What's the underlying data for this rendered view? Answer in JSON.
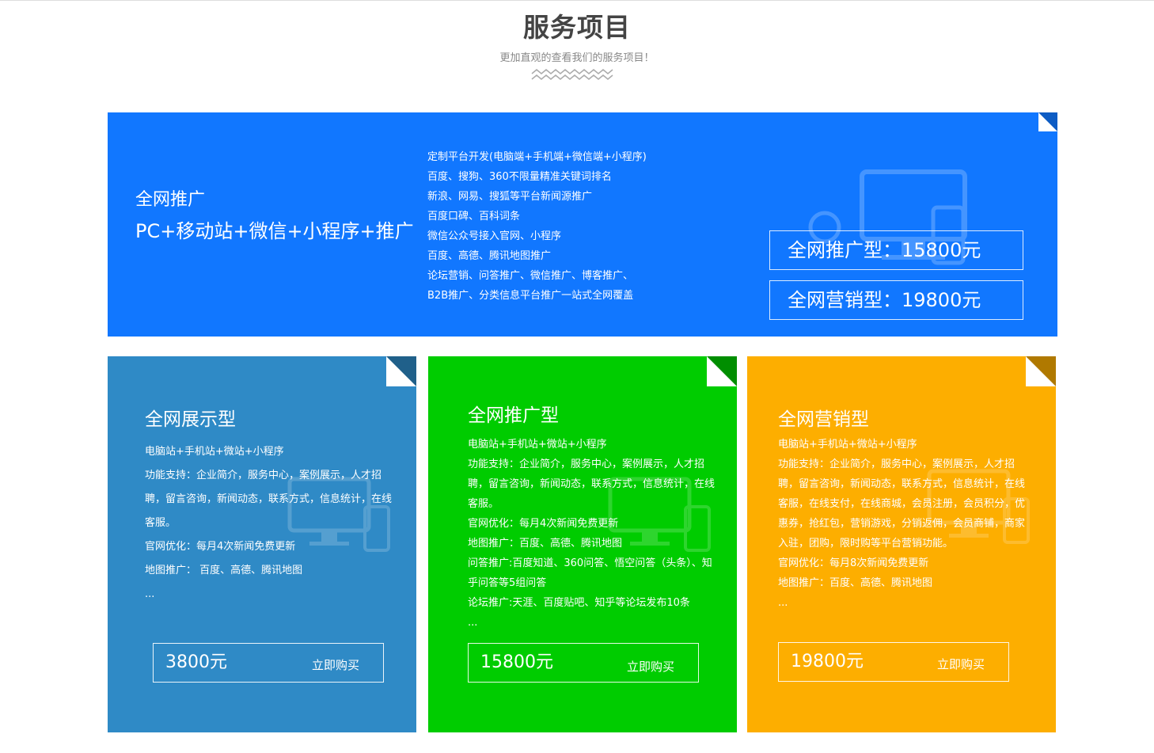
{
  "section": {
    "title": "服务项目",
    "subtitle": "更加直观的查看我们的服务项目！"
  },
  "banner": {
    "title": "全网推广",
    "subtitle": "PC+移动站+微信+小程序+推广",
    "features": [
      "定制平台开发(电脑端+手机端+微信端+小程序)",
      "百度、搜狗、360不限量精准关键词排名",
      "新浪、网易、搜狐等平台新闻源推广",
      "百度口碑、百科词条",
      "微信公众号接入官网、小程序",
      "百度、高德、腾讯地图推广",
      "论坛营销、问答推广、微信推广、博客推广、",
      "B2B推广、分类信息平台推广一站式全网覆盖"
    ],
    "price_options": [
      "全网推广型：15800元",
      "全网营销型：19800元"
    ],
    "color": "#1177ff",
    "icon": "monitor-phone-icon"
  },
  "cards": [
    {
      "title": "全网展示型",
      "features": [
        "电脑站+手机站+微站+小程序",
        "功能支持：企业简介，服务中心，案例展示，人才招聘，留言咨询，新闻动态，联系方式，信息统计，在线客服。",
        "官网优化：每月4次新闻免费更新",
        "地图推广： 百度、高德、腾讯地图",
        "..."
      ],
      "price": "3800元",
      "buy_label": "立即购买",
      "color": "#2f8ac6",
      "icon": "monitor-phone-icon"
    },
    {
      "title": "全网推广型",
      "features": [
        "电脑站+手机站+微站+小程序",
        "功能支持：企业简介，服务中心，案例展示，人才招聘，留言咨询，新闻动态，联系方式，信息统计，在线客服。",
        "官网优化：每月4次新闻免费更新",
        "地图推广：百度、高德、腾讯地图",
        "问答推广:百度知道、360问答、悟空问答（头条）、知乎问答等5组问答",
        "论坛推广:天涯、百度贴吧、知乎等论坛发布10条",
        "..."
      ],
      "price": "15800元",
      "buy_label": "立即购买",
      "color": "#00cc00",
      "icon": "monitor-phone-icon"
    },
    {
      "title": "全网营销型",
      "features": [
        "电脑站+手机站+微站+小程序",
        "功能支持：企业简介，服务中心，案例展示，人才招聘，留言咨询，新闻动态，联系方式，信息统计，在线客服，在线支付，在线商城，会员注册，会员积分，优惠券，抢红包，营销游戏，分销返佣，会员商铺，商家入驻，团购，限时购等平台营销功能。",
        "官网优化：每月8次新闻免费更新",
        "地图推广：百度、高德、腾讯地图",
        "..."
      ],
      "price": "19800元",
      "buy_label": "立即购买",
      "color": "#fdae00",
      "icon": "monitor-phone-icon"
    }
  ]
}
